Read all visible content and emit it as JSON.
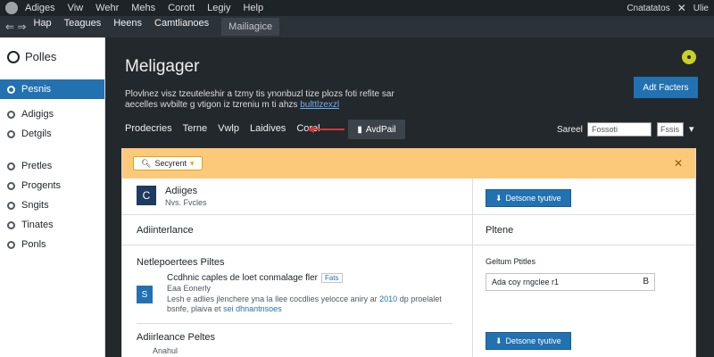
{
  "topbar": {
    "menu": [
      "Adiges",
      "Viw",
      "Wehr",
      "Mehs",
      "Corott",
      "Legiy",
      "Help"
    ],
    "right_text": "Cnatatatos",
    "right_small": "Ulie"
  },
  "navbar": {
    "tabs": [
      "Hap",
      "Teagues",
      "Heens",
      "Camtlianoes",
      "Mailiagice"
    ]
  },
  "sidebar": {
    "brand": "Polles",
    "items": [
      {
        "label": "Pesnis",
        "icon": "pin-icon",
        "active": true
      },
      {
        "label": "Adigigs"
      },
      {
        "label": "Detgils"
      },
      {
        "label": "Pretles"
      },
      {
        "label": "Progents"
      },
      {
        "label": "Sngits"
      },
      {
        "label": "Tinates"
      },
      {
        "label": "Ponls"
      }
    ]
  },
  "header": {
    "title": "Meligager",
    "description": "Plovlnez visz tzeuteleshir a tzmy tis ynonbuzl tize plozs foti refite sar aecelles wvbilte g vtigon iz tzreniu m ti ahzs",
    "description_link": "bulttlzexzl",
    "tabs": [
      "Prodecries",
      "Terne",
      "Vwlp",
      "Laidives",
      "Corel"
    ],
    "add_button": "AvdPail",
    "search_label": "Sareel",
    "search_placeholder": "Fossoti",
    "sort_value": "Fssis",
    "add_new_label": "Adt Facters"
  },
  "notice": {
    "pill_label": "Secyrent"
  },
  "left": {
    "card_title": "Adiiges",
    "card_sub": "Nvs. Fvcles",
    "card_icon": "C",
    "section1": "Adiinterlance",
    "section2": "Netlepoertees Piltes",
    "item_title": "Ccdhnic caples de loet conmalage fler",
    "item_tag": "Fats",
    "item_author": "Eaa Eonerly",
    "item_icon": "S",
    "item_desc": "Lesh e adlies jlenchere yna la llee cocdlies yelocce aniry ar",
    "item_desc_link1": "2010",
    "item_desc_mid": "dp proelalet bsnfe, plaiva et",
    "item_desc_link2": "sei dhnantnsoes",
    "section3": "Adiirleance Peltes",
    "section3_sub": "Anahul"
  },
  "right": {
    "button_label": "Detsone tyutive",
    "section1": "Pltene",
    "label": "Geltum Ptitles",
    "field_value": "Ada coy rngclee r1",
    "field_icon": "B",
    "button2_label": "Detsone tyutive"
  }
}
